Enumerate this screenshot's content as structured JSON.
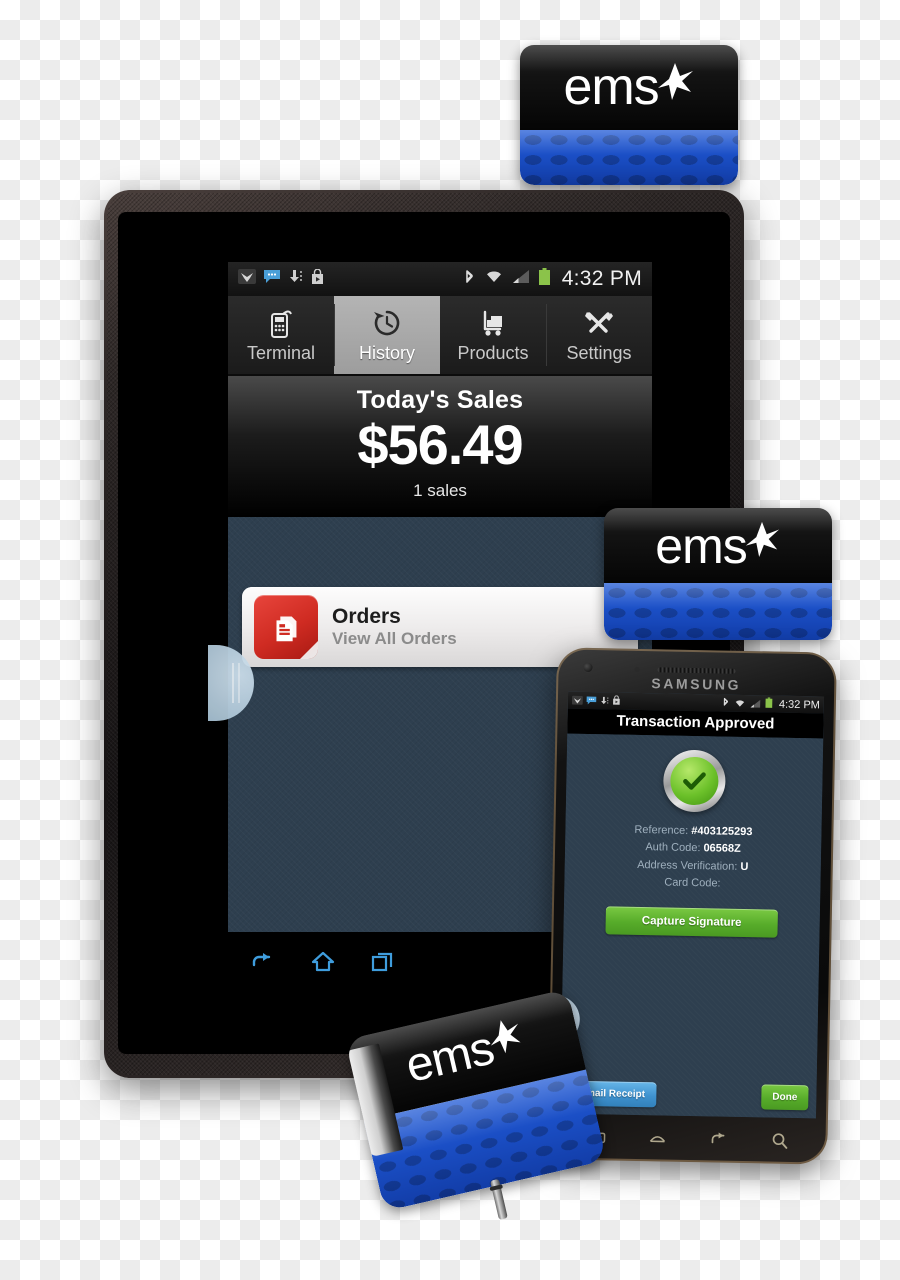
{
  "product": {
    "brand": "ems",
    "reader_label": "ems"
  },
  "tablet": {
    "status_bar": {
      "time": "4:32 PM",
      "left_icons": [
        "network-bird-icon",
        "sms-message-icon",
        "download-icon",
        "play-store-icon"
      ],
      "right_icons": [
        "bluetooth-icon",
        "wifi-icon",
        "cellular-signal-icon",
        "battery-icon"
      ]
    },
    "tabs": [
      {
        "label": "Terminal",
        "icon": "card-terminal-icon",
        "active": false
      },
      {
        "label": "History",
        "icon": "clock-history-icon",
        "active": true
      },
      {
        "label": "Products",
        "icon": "hand-truck-icon",
        "active": false
      },
      {
        "label": "Settings",
        "icon": "tools-wrench-icon",
        "active": false
      }
    ],
    "sales": {
      "title": "Today's Sales",
      "amount": "$56.49",
      "count": "1 sales"
    },
    "cards": [
      {
        "title": "Orders",
        "subtitle": "View All Orders",
        "icon": "orders-document-icon"
      }
    ],
    "nav": [
      "back-icon",
      "home-icon",
      "recent-apps-icon"
    ]
  },
  "phone": {
    "brand": "SAMSUNG",
    "status_bar": {
      "time": "4:32 PM",
      "left_icons": [
        "network-bird-icon",
        "sms-message-icon",
        "download-icon",
        "play-store-icon"
      ],
      "right_icons": [
        "bluetooth-icon",
        "wifi-icon",
        "cellular-signal-icon",
        "battery-icon"
      ]
    },
    "title": "Transaction Approved",
    "status_icon": "approved-checkmark-icon",
    "fields": [
      {
        "label": "Reference:",
        "value": "#403125293"
      },
      {
        "label": "Auth Code:",
        "value": "06568Z"
      },
      {
        "label": "Address Verification:",
        "value": "U"
      },
      {
        "label": "Card Code:",
        "value": ""
      }
    ],
    "capture_button": "Capture Signature",
    "email_button": "Email Receipt",
    "done_button": "Done",
    "nav": [
      "menu-icon",
      "home-icon",
      "back-icon",
      "search-icon"
    ]
  },
  "colors": {
    "green_button": "#57ac2a",
    "blue_button": "#3f92cf",
    "reader_blue": "#1b4fc6",
    "screen_bg": "#2e3f4f",
    "orders_red": "#cf2b22",
    "active_tab": "#a8a8a8"
  }
}
